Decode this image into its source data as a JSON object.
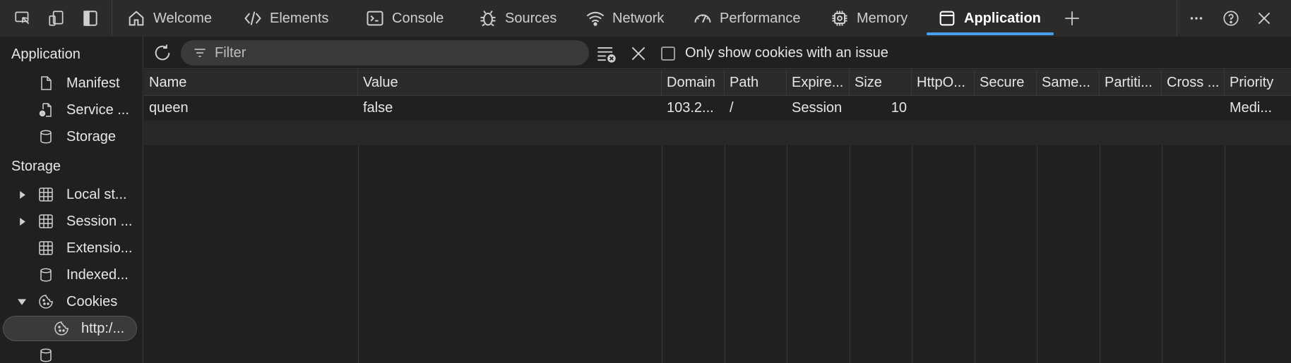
{
  "toolbar": {
    "tabs": [
      {
        "label": "Welcome",
        "icon": "home-icon"
      },
      {
        "label": "Elements",
        "icon": "code-icon"
      },
      {
        "label": "Console",
        "icon": "console-icon"
      },
      {
        "label": "Sources",
        "icon": "bug-icon"
      },
      {
        "label": "Network",
        "icon": "wifi-icon"
      },
      {
        "label": "Performance",
        "icon": "gauge-icon"
      },
      {
        "label": "Memory",
        "icon": "chip-icon"
      },
      {
        "label": "Application",
        "icon": "window-icon",
        "active": true
      }
    ],
    "accent_color": "#4aa0f0"
  },
  "sidebar": {
    "application_header": "Application",
    "application_items": [
      {
        "label": "Manifest",
        "icon": "document-icon"
      },
      {
        "label": "Service ...",
        "icon": "gear-document-icon"
      },
      {
        "label": "Storage",
        "icon": "database-icon"
      }
    ],
    "storage_header": "Storage",
    "storage_items": [
      {
        "label": "Local st...",
        "icon": "grid-icon",
        "expandable": true
      },
      {
        "label": "Session ...",
        "icon": "grid-icon",
        "expandable": true
      },
      {
        "label": "Extensio...",
        "icon": "grid-icon"
      },
      {
        "label": "Indexed...",
        "icon": "database-icon"
      },
      {
        "label": "Cookies",
        "icon": "cookie-icon",
        "expanded": true
      },
      {
        "label": "http:/...",
        "icon": "cookie-icon",
        "selected": true
      }
    ]
  },
  "filterbar": {
    "filter_placeholder": "Filter",
    "only_issue_label": "Only show cookies with an issue"
  },
  "table": {
    "columns": [
      "Name",
      "Value",
      "Domain",
      "Path",
      "Expire...",
      "Size",
      "HttpO...",
      "Secure",
      "Same...",
      "Partiti...",
      "Cross ...",
      "Priority"
    ],
    "rows": [
      {
        "name": "queen",
        "value": "false",
        "domain": "103.2...",
        "path": "/",
        "expires": "Session",
        "size": "10",
        "httponly": "",
        "secure": "",
        "samesite": "",
        "partition": "",
        "cross": "",
        "priority": "Medi..."
      }
    ]
  }
}
